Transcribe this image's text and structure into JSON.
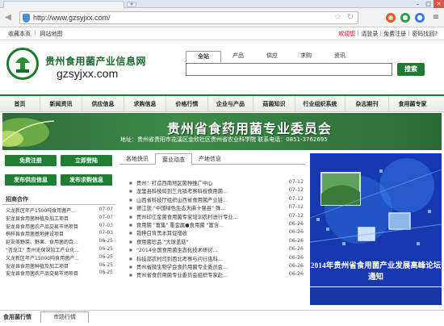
{
  "browser": {
    "url": "http://www.gzsyjxx.com/",
    "new_tab": "+",
    "window_controls": [
      "–",
      "□",
      "✕"
    ],
    "nav_buttons": [
      "◀",
      "▶"
    ],
    "extension_colors": [
      "#e05a2a",
      "#2a9d4a",
      "#3a7bd5"
    ]
  },
  "topbar": {
    "left": "收藏本页 ｜ 网站地图",
    "welcome": "欢迎您",
    "right": "｜请登录｜免费注册｜密码找回?"
  },
  "header": {
    "title": "贵州食用菌产业信息网",
    "domain": "gzsyjxx.com",
    "search_tabs": [
      "全站",
      "产品",
      "供应",
      "求购",
      "资讯"
    ],
    "search_value": "",
    "search_button": "搜索"
  },
  "mainnav": [
    "首页",
    "新闻资讯",
    "供应信息",
    "求购信息",
    "价格行情",
    "企业与产品",
    "菇菌知识",
    "行业组织系统",
    "杂志期刊",
    "食用菌专家"
  ],
  "banner": {
    "title": "贵州省食药用菌专业委员会",
    "subtitle": "地址：贵州省贵阳市花溪区金欣社区贵州省农业科学院   联系电话：0851-3762695"
  },
  "left": {
    "buttons": [
      "免费注册",
      "立即登陆",
      "发布供应信息",
      "发布求购信息"
    ],
    "section_title": "招商合作",
    "items": [
      {
        "text": "义龙新区年产1500吨食用菌产...",
        "date": "07-07"
      },
      {
        "text": "安龙县食用菌种植及加工项目",
        "date": "07-07"
      },
      {
        "text": "安龙县食用菌农产品交易市场项目",
        "date": "07-03"
      },
      {
        "text": "桐梓县食用菌基地建设项目",
        "date": "07-03"
      },
      {
        "text": "延安美野菜、野果、食用菌的合...",
        "date": "06-25"
      },
      {
        "text": "\"咨龙江\" 贵州无保深加工产业化...",
        "date": "06-25"
      },
      {
        "text": "义龙新区年产15000吨食用菌产...",
        "date": "06-25"
      },
      {
        "text": "安龙县食用菌种植及加工项目",
        "date": "06-25"
      },
      {
        "text": "安龙县食用菌农产品交易市场项目",
        "date": "06-25"
      }
    ]
  },
  "middle": {
    "tabs": [
      "各地快讯",
      "菌业动态",
      "产地信息"
    ],
    "active_tab": 1,
    "news": [
      {
        "text": "贵州：打造西南地区菌种推广中心",
        "date": "07-12"
      },
      {
        "text": "龙里县科技局到三元镇考察科技食用菌...",
        "date": "07-12"
      },
      {
        "text": "山西省科技厅组织山西省食用菌产业链...",
        "date": "07-12"
      },
      {
        "text": "德江获 \"中国绿色生态天麻十强县\" 殊...",
        "date": "07-12"
      },
      {
        "text": "贵州印江金菌食用菌专家培训农村进行专业...",
        "date": "07-12"
      },
      {
        "text": "食用菌 \"富集\" 重金属●食用菌 \"富含...",
        "date": "06-26"
      },
      {
        "text": "栽种白背黑木耳促增收",
        "date": "06-26"
      },
      {
        "text": "食用菌珍品 \"大球盖菇\"",
        "date": "06-26"
      },
      {
        "text": "\"2014全国食用菌生态化技术研讨...",
        "date": "06-26"
      },
      {
        "text": "科技部农村司到西北考察与问行巫科...",
        "date": "06-26"
      },
      {
        "text": "贵州省微生物学会食药用菌专业委员会...",
        "date": "06-26"
      },
      {
        "text": "贵州省食药用菌专业委员会组织专家赴...",
        "date": "06-26"
      }
    ]
  },
  "right_image": {
    "caption": "2014年贵州省食用菌产业发展高峰论坛通知"
  },
  "bottom": {
    "title": "食用菌行情",
    "tab": "市场行情"
  }
}
